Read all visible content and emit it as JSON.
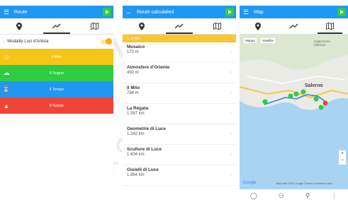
{
  "phone1": {
    "title": "Route",
    "toggle_label": "Modality Luci d'Artista",
    "categories": [
      {
        "label": "Il Mito",
        "color": "#f5c518",
        "icon": "diamond-icon"
      },
      {
        "label": "Il Sogno",
        "color": "#2ecc40",
        "icon": "cloud-icon"
      },
      {
        "label": "Il Tempo",
        "color": "#2196f3",
        "icon": "hourglass-icon"
      },
      {
        "label": "Il Natale",
        "color": "#f04335",
        "icon": "tree-icon"
      }
    ]
  },
  "phone2": {
    "title": "Route calculated",
    "banner": "Il Mito",
    "routes": [
      {
        "name": "Mosaico",
        "dist": "172 m"
      },
      {
        "name": "Atmosfere d'Oriente",
        "dist": "492 m"
      },
      {
        "name": "Il Mito",
        "dist": "784 m"
      },
      {
        "name": "La Regata",
        "dist": "1.067 km"
      },
      {
        "name": "Geometrie di Luce",
        "dist": "1.242 km"
      },
      {
        "name": "Sculture di Luce",
        "dist": "1.604 km"
      },
      {
        "name": "Gioielli di Luce",
        "dist": "1.864 km"
      }
    ]
  },
  "phone3": {
    "title": "Map",
    "map_type_1": "Mappa",
    "map_type_2": "Satellite",
    "city_label": "Salerno",
    "area_label": "Capezzano Inferiore",
    "google_logo": "Google",
    "map_credits": "Map data ©2017 Google  Termini e condizioni d'uso"
  },
  "watermark": {
    "line1": "SCIENCE",
    "line2": "TECHNOLOGY PUBLICATIONS"
  }
}
